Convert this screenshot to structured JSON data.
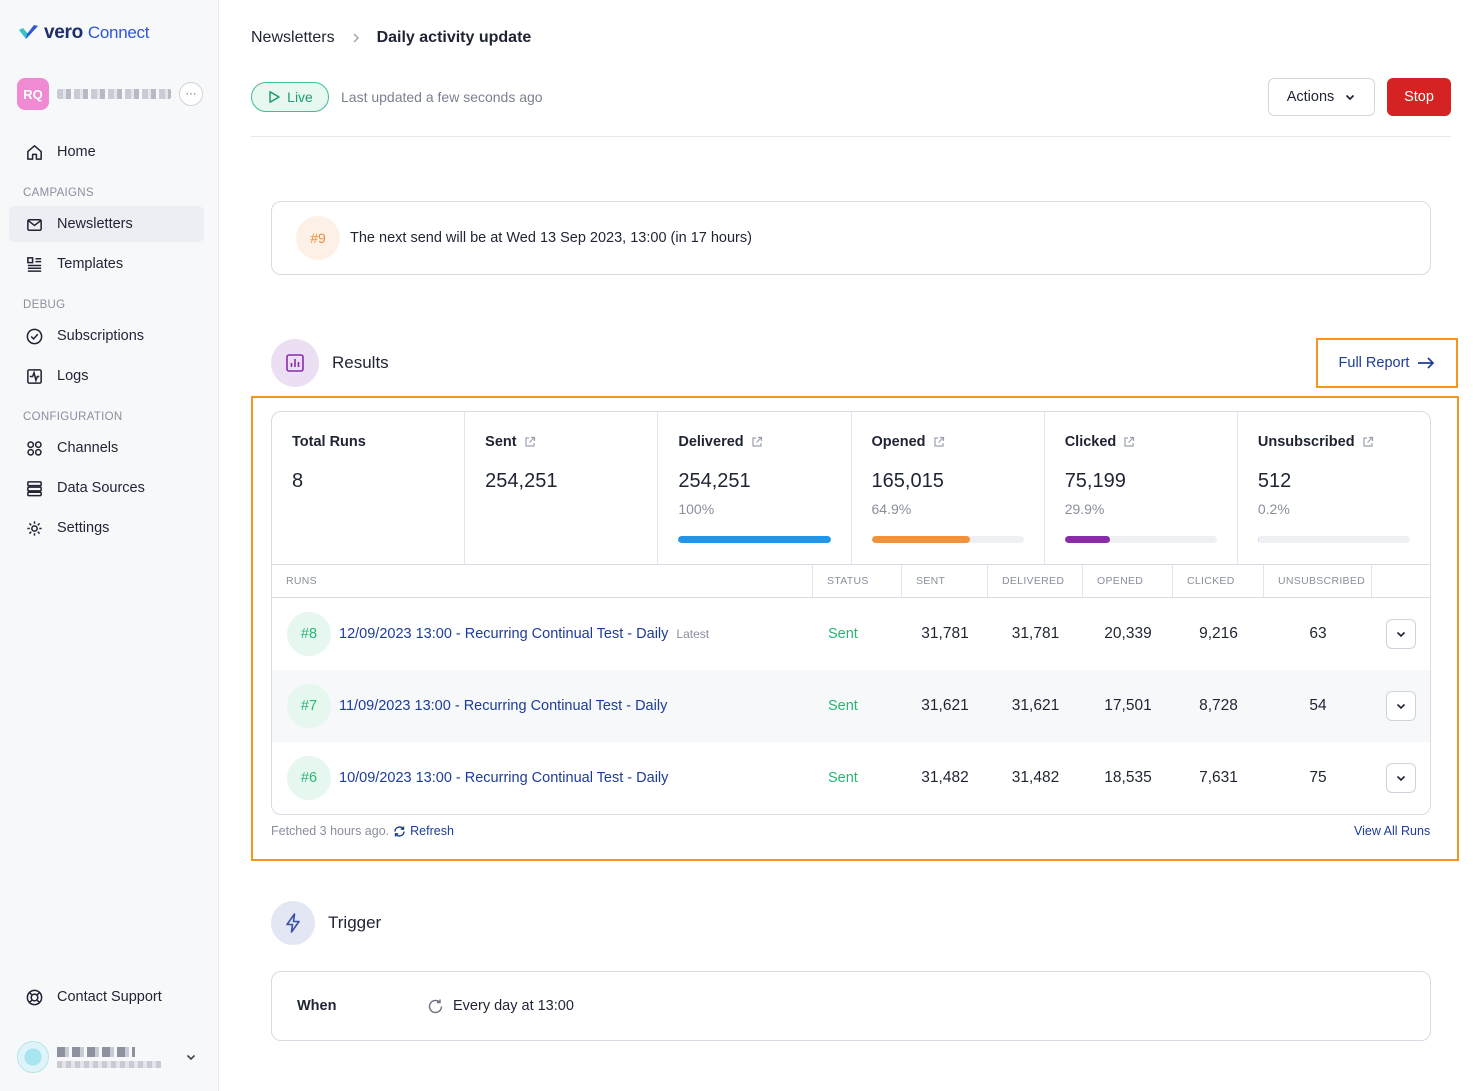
{
  "brand": {
    "name": "vero",
    "product": "Connect"
  },
  "account": {
    "initials": "RQ"
  },
  "sidebar": {
    "home": "Home",
    "sections": {
      "campaigns": "CAMPAIGNS",
      "debug": "DEBUG",
      "configuration": "CONFIGURATION"
    },
    "items": {
      "newsletters": "Newsletters",
      "templates": "Templates",
      "subscriptions": "Subscriptions",
      "logs": "Logs",
      "channels": "Channels",
      "data_sources": "Data Sources",
      "settings": "Settings",
      "contact_support": "Contact Support"
    }
  },
  "breadcrumb": {
    "parent": "Newsletters",
    "current": "Daily activity update"
  },
  "status": {
    "badge": "Live",
    "last_updated": "Last updated a few seconds ago"
  },
  "toolbar": {
    "actions_label": "Actions",
    "stop_label": "Stop"
  },
  "next_send": {
    "run_label": "#9",
    "text": "The next send will be at Wed 13 Sep 2023, 13:00 (in 17 hours)"
  },
  "results": {
    "title": "Results",
    "full_report": "Full Report",
    "stats": [
      {
        "label": "Total Runs",
        "value": "8",
        "pct": "",
        "fill": null,
        "color": null
      },
      {
        "label": "Sent",
        "value": "254,251",
        "pct": "",
        "fill": null,
        "color": null
      },
      {
        "label": "Delivered",
        "value": "254,251",
        "pct": "100%",
        "fill": 1.0,
        "color": "#2196e8"
      },
      {
        "label": "Opened",
        "value": "165,015",
        "pct": "64.9%",
        "fill": 0.649,
        "color": "#f2923d"
      },
      {
        "label": "Clicked",
        "value": "75,199",
        "pct": "29.9%",
        "fill": 0.299,
        "color": "#8a2ba8"
      },
      {
        "label": "Unsubscribed",
        "value": "512",
        "pct": "0.2%",
        "fill": 0.002,
        "color": "#d0d3da"
      }
    ],
    "columns": [
      "RUNS",
      "STATUS",
      "SENT",
      "DELIVERED",
      "OPENED",
      "CLICKED",
      "UNSUBSCRIBED"
    ],
    "runs": [
      {
        "num": "#8",
        "name": "12/09/2023 13:00 - Recurring Continual Test - Daily",
        "tag": "Latest",
        "status": "Sent",
        "sent": "31,781",
        "delivered": "31,781",
        "opened": "20,339",
        "clicked": "9,216",
        "unsubscribed": "63"
      },
      {
        "num": "#7",
        "name": "11/09/2023 13:00 - Recurring Continual Test - Daily",
        "tag": "",
        "status": "Sent",
        "sent": "31,621",
        "delivered": "31,621",
        "opened": "17,501",
        "clicked": "8,728",
        "unsubscribed": "54"
      },
      {
        "num": "#6",
        "name": "10/09/2023 13:00 - Recurring Continual Test - Daily",
        "tag": "",
        "status": "Sent",
        "sent": "31,482",
        "delivered": "31,482",
        "opened": "18,535",
        "clicked": "7,631",
        "unsubscribed": "75"
      }
    ],
    "fetched": "Fetched 3 hours ago.",
    "refresh": "Refresh",
    "view_all": "View All Runs"
  },
  "trigger": {
    "title": "Trigger",
    "when_label": "When",
    "when_value": "Every day at 13:00"
  },
  "colors": {
    "accent": "#1c3c9c",
    "danger": "#d52222",
    "success": "#2bb673",
    "highlight": "#f7941d"
  }
}
